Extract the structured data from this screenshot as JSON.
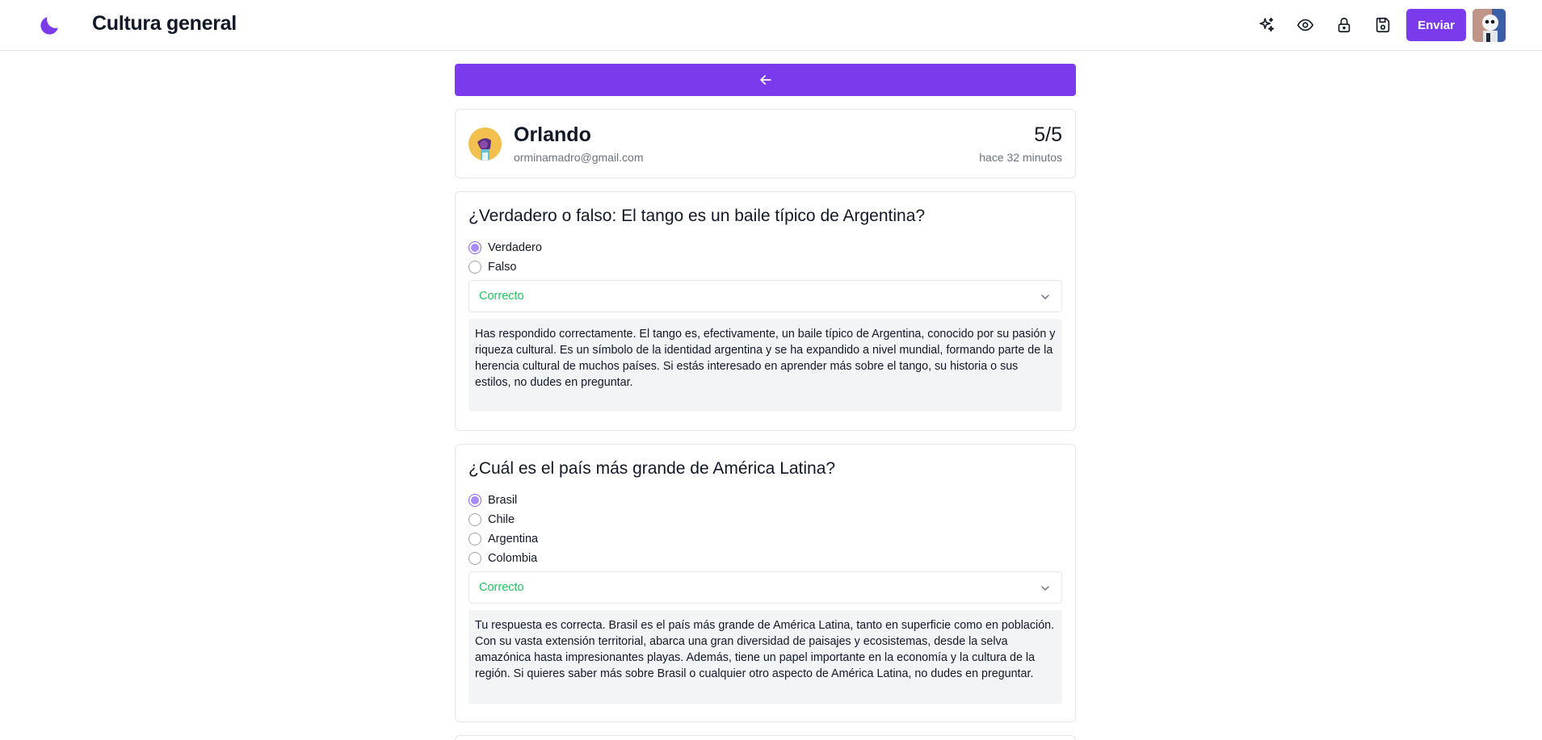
{
  "header": {
    "title": "Cultura general",
    "send_label": "Enviar",
    "icons": [
      "moon-logo-icon",
      "sparkles-icon",
      "eye-icon",
      "lock-icon",
      "save-icon"
    ]
  },
  "colors": {
    "accent": "#7c3aed",
    "correct": "#22c55e",
    "muted": "#6b7280"
  },
  "submission": {
    "name": "Orlando",
    "email": "orminamadro@gmail.com",
    "score": "5/5",
    "time": "hace 32 minutos"
  },
  "questions": [
    {
      "title": "¿Verdadero o falso: El tango es un baile típico de Argentina?",
      "options": [
        {
          "label": "Verdadero",
          "selected": true
        },
        {
          "label": "Falso",
          "selected": false
        }
      ],
      "result": "Correcto",
      "feedback": "Has respondido correctamente. El tango es, efectivamente, un baile típico de Argentina, conocido por su pasión y riqueza cultural. Es un símbolo de la identidad argentina y se ha expandido a nivel mundial, formando parte de la herencia cultural de muchos países. Si estás interesado en aprender más sobre el tango, su historia o sus estilos, no dudes en preguntar."
    },
    {
      "title": "¿Cuál es el país más grande de América Latina?",
      "options": [
        {
          "label": "Brasil",
          "selected": true
        },
        {
          "label": "Chile",
          "selected": false
        },
        {
          "label": "Argentina",
          "selected": false
        },
        {
          "label": "Colombia",
          "selected": false
        }
      ],
      "result": "Correcto",
      "feedback": "Tu respuesta es correcta. Brasil es el país más grande de América Latina, tanto en superficie como en población. Con su vasta extensión territorial, abarca una gran diversidad de paisajes y ecosistemas, desde la selva amazónica hasta impresionantes playas. Además, tiene un papel importante en la economía y la cultura de la región. Si quieres saber más sobre Brasil o cualquier otro aspecto de América Latina, no dudes en preguntar."
    }
  ]
}
